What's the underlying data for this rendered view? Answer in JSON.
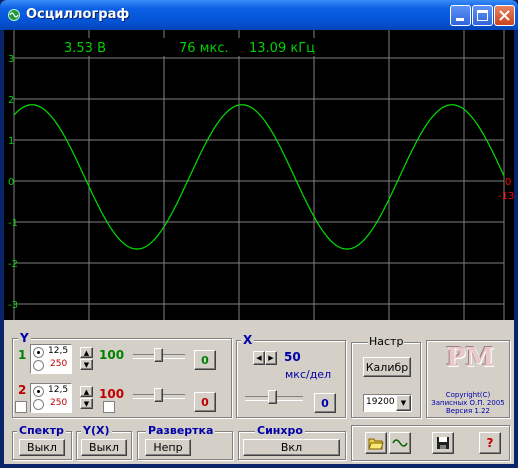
{
  "window": {
    "title": "Осциллограф"
  },
  "scope": {
    "readout": {
      "voltage": "3.53 В",
      "period": "76 мкс.",
      "freq": "13.09 кГц"
    },
    "y_ticks": [
      "3",
      "2",
      "1",
      "0",
      "-1",
      "-2",
      "-3"
    ],
    "right_marks": {
      "ch1": "0",
      "ch2": "-13"
    },
    "colors": {
      "trace": "#00e000",
      "grid": "#808080",
      "readout": "#00d000",
      "marker": "#ff0000"
    }
  },
  "chart_data": {
    "type": "line",
    "series": [
      {
        "color": "#00e000",
        "amplitude": 1.76,
        "period_div": 2.8,
        "offset": 0.1
      }
    ],
    "ylim": [
      -3.3,
      3.3
    ],
    "grid": true
  },
  "y_panel": {
    "title": "Y",
    "ch1": {
      "num": "1",
      "r1": "12,5",
      "r2": "250",
      "value": "100",
      "btn": "0"
    },
    "ch2": {
      "num": "2",
      "r1": "12,5",
      "r2": "250",
      "value": "100",
      "btn": "0"
    }
  },
  "x_panel": {
    "title": "X",
    "value": "50",
    "unit": "мкс/дел",
    "btn": "0"
  },
  "settings": {
    "title": "Настр",
    "calib": "Калибр",
    "baud": "19200"
  },
  "logo": {
    "letters": "PM",
    "line1": "Copyright(C)",
    "line2": "Записных О.П. 2005",
    "line3": "Версия 1.22"
  },
  "bottom": {
    "spectrum": {
      "title": "Спектр",
      "btn": "Выкл"
    },
    "yx": {
      "title": "Y(X)",
      "btn": "Выкл"
    },
    "sweep": {
      "title": "Развертка",
      "btn": "Непр"
    },
    "sync": {
      "title": "Синхро",
      "btn": "Вкл"
    },
    "help": "?"
  }
}
